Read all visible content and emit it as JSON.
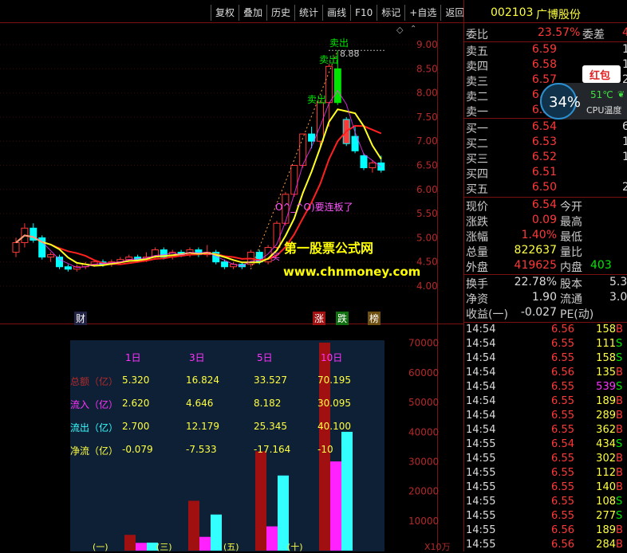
{
  "toolbar": {
    "buttons": [
      "复权",
      "叠加",
      "历史",
      "统计",
      "画线",
      "F10",
      "标记",
      "+自选",
      "返回"
    ]
  },
  "stock": {
    "code": "002103",
    "name": "广博股份"
  },
  "colors": {
    "up": "#ff3838",
    "down": "#00ffff",
    "green": "#00e600",
    "yellow": "#ffff00",
    "magenta": "#ff33ff",
    "dark_red": "#a01010"
  },
  "order_book": {
    "weibi_label": "委比",
    "weibi_value": "23.57%",
    "weicha_label": "委差",
    "weicha_value": "4",
    "asks": [
      {
        "label": "卖五",
        "price": "6.59",
        "vol": "1"
      },
      {
        "label": "卖四",
        "price": "6.58",
        "vol": "1"
      },
      {
        "label": "卖三",
        "price": "6.57",
        "vol": "2"
      },
      {
        "label": "卖二",
        "price": "6.56",
        "vol": ""
      },
      {
        "label": "卖一",
        "price": "6.55",
        "vol": ""
      }
    ],
    "bids": [
      {
        "label": "买一",
        "price": "6.54",
        "vol": "6"
      },
      {
        "label": "买二",
        "price": "6.53",
        "vol": "1"
      },
      {
        "label": "买三",
        "price": "6.52",
        "vol": "1"
      },
      {
        "label": "买四",
        "price": "6.51",
        "vol": ""
      },
      {
        "label": "买五",
        "price": "6.50",
        "vol": "2"
      }
    ]
  },
  "quote": [
    {
      "label": "现价",
      "value": "6.54",
      "label2": "今开",
      "value2": ""
    },
    {
      "label": "涨跌",
      "value": "0.09",
      "label2": "最高",
      "value2": ""
    },
    {
      "label": "涨幅",
      "value": "1.40%",
      "label2": "最低",
      "value2": ""
    },
    {
      "label": "总量",
      "value": "822637",
      "label2": "量比",
      "value2": ""
    },
    {
      "label": "外盘",
      "value": "419625",
      "label2": "内盘",
      "value2": "403"
    }
  ],
  "fundamentals": [
    {
      "label": "换手",
      "value": "22.78%",
      "label2": "股本",
      "value2": "5.3"
    },
    {
      "label": "净资",
      "value": "1.90",
      "label2": "流通",
      "value2": "3.0"
    },
    {
      "label": "收益(一)",
      "value": "-0.027",
      "label2": "PE(动)",
      "value2": ""
    }
  ],
  "ticks": [
    {
      "time": "14:54",
      "price": "6.56",
      "vol": "158",
      "side": "B"
    },
    {
      "time": "14:54",
      "price": "6.55",
      "vol": "111",
      "side": "S"
    },
    {
      "time": "14:54",
      "price": "6.55",
      "vol": "158",
      "side": "S"
    },
    {
      "time": "14:54",
      "price": "6.56",
      "vol": "135",
      "side": "B"
    },
    {
      "time": "14:54",
      "price": "6.55",
      "vol": "539",
      "side": "S"
    },
    {
      "time": "14:54",
      "price": "6.55",
      "vol": "189",
      "side": "B"
    },
    {
      "time": "14:54",
      "price": "6.55",
      "vol": "289",
      "side": "B"
    },
    {
      "time": "14:54",
      "price": "6.55",
      "vol": "362",
      "side": "B"
    },
    {
      "time": "14:55",
      "price": "6.54",
      "vol": "434",
      "side": "S"
    },
    {
      "time": "14:55",
      "price": "6.55",
      "vol": "302",
      "side": "B"
    },
    {
      "time": "14:55",
      "price": "6.55",
      "vol": "112",
      "side": "B"
    },
    {
      "time": "14:55",
      "price": "6.55",
      "vol": "140",
      "side": "B"
    },
    {
      "time": "14:55",
      "price": "6.55",
      "vol": "108",
      "side": "S"
    },
    {
      "time": "14:55",
      "price": "6.55",
      "vol": "277",
      "side": "S"
    },
    {
      "time": "14:55",
      "price": "6.56",
      "vol": "189",
      "side": "B"
    },
    {
      "time": "14:55",
      "price": "6.56",
      "vol": "284",
      "side": "B"
    }
  ],
  "overlay": {
    "hongbao": "红包",
    "cpu_percent": "34%",
    "cpu_temp": "51℃",
    "cpu_label": "CPU温度"
  },
  "chart_annotations": {
    "sell_labels": [
      "卖出",
      "卖出",
      "卖出"
    ],
    "high_price": "8.88",
    "pattern_text": "O^_^O)要连板了",
    "watermark_title": "第一股票公式网",
    "watermark_url": "www.chnmoney.com",
    "buy_tag": "买",
    "marker_cai": "财",
    "marker_zhang": "涨",
    "marker_die": "跌",
    "marker_bang": "榜"
  },
  "chart_data": [
    {
      "type": "candlestick",
      "y_axis_labels": [
        "9.00",
        "8.50",
        "8.00",
        "7.50",
        "7.00",
        "6.50",
        "6.00",
        "5.50",
        "5.00",
        "4.50",
        "4.00"
      ],
      "ylim": [
        3.9,
        9.15
      ],
      "candles": [
        [
          4.7,
          4.9,
          4.6,
          5.0
        ],
        [
          4.9,
          5.2,
          4.8,
          5.3
        ],
        [
          5.2,
          4.95,
          4.9,
          5.3
        ],
        [
          5.0,
          4.6,
          4.55,
          5.05
        ],
        [
          4.6,
          4.65,
          4.5,
          4.7
        ],
        [
          4.6,
          4.4,
          4.35,
          4.65
        ],
        [
          4.4,
          4.35,
          4.3,
          4.45
        ],
        [
          4.35,
          4.4,
          4.3,
          4.45
        ],
        [
          4.4,
          4.45,
          4.35,
          4.5
        ],
        [
          4.45,
          4.5,
          4.4,
          4.55
        ],
        [
          4.5,
          4.45,
          4.4,
          4.55
        ],
        [
          4.45,
          4.5,
          4.4,
          4.55
        ],
        [
          4.5,
          4.55,
          4.45,
          4.6
        ],
        [
          4.55,
          4.6,
          4.5,
          4.65
        ],
        [
          4.6,
          4.55,
          4.5,
          4.65
        ],
        [
          4.55,
          4.6,
          4.5,
          4.7
        ],
        [
          4.6,
          4.75,
          4.55,
          4.8
        ],
        [
          4.75,
          4.6,
          4.55,
          4.8
        ],
        [
          4.6,
          4.7,
          4.55,
          4.75
        ],
        [
          4.7,
          4.65,
          4.6,
          4.75
        ],
        [
          4.65,
          4.75,
          4.6,
          4.8
        ],
        [
          4.75,
          4.65,
          4.6,
          4.8
        ],
        [
          4.65,
          4.7,
          4.6,
          4.85
        ],
        [
          4.7,
          4.5,
          4.45,
          4.75
        ],
        [
          4.5,
          4.4,
          4.35,
          4.55
        ],
        [
          4.4,
          4.45,
          4.35,
          4.5
        ],
        [
          4.45,
          4.4,
          4.35,
          4.5
        ],
        [
          4.45,
          4.7,
          4.4,
          4.75
        ],
        [
          4.7,
          4.5,
          4.45,
          4.75
        ],
        [
          4.5,
          4.8,
          4.45,
          4.85
        ],
        [
          4.8,
          5.3,
          4.75,
          5.35
        ],
        [
          5.3,
          5.9,
          5.25,
          5.95
        ],
        [
          5.9,
          6.5,
          5.85,
          6.5
        ],
        [
          6.5,
          7.15,
          6.45,
          7.15
        ],
        [
          7.15,
          7.0,
          6.85,
          7.3
        ],
        [
          7.0,
          7.8,
          6.9,
          7.85
        ],
        [
          7.8,
          8.55,
          7.3,
          8.6
        ],
        [
          8.5,
          7.8,
          7.75,
          8.88
        ],
        [
          7.45,
          6.95,
          6.9,
          7.5
        ],
        [
          7.1,
          6.8,
          6.75,
          7.3
        ],
        [
          6.7,
          6.45,
          6.4,
          6.75
        ],
        [
          6.45,
          6.55,
          6.35,
          6.6
        ],
        [
          6.55,
          6.4,
          6.35,
          6.7
        ]
      ]
    },
    {
      "type": "bar",
      "categories": [
        "(一)",
        "(三)",
        "(五)",
        "(十)"
      ],
      "unit_label": "X10万",
      "y_axis_labels": [
        "70000",
        "60000",
        "50000",
        "40000",
        "30000",
        "20000",
        "10000"
      ],
      "ylim": [
        0,
        71000
      ],
      "series": [
        {
          "name": "总额",
          "values": [
            5320,
            16824,
            33527,
            70195
          ]
        },
        {
          "name": "流入",
          "values": [
            2620,
            4646,
            8182,
            30095
          ]
        },
        {
          "name": "流出",
          "values": [
            2700,
            12179,
            25345,
            40100
          ]
        }
      ]
    }
  ],
  "fund_table": {
    "headers": [
      "1日",
      "3日",
      "5日",
      "10日"
    ],
    "rows": [
      {
        "label": "总额（亿）",
        "values": [
          "5.320",
          "16.824",
          "33.527",
          "70.195"
        ]
      },
      {
        "label": "流入（亿）",
        "values": [
          "2.620",
          "4.646",
          "8.182",
          "30.095"
        ]
      },
      {
        "label": "流出（亿）",
        "values": [
          "2.700",
          "12.179",
          "25.345",
          "40.100"
        ]
      },
      {
        "label": "净流（亿）",
        "values": [
          "-0.079",
          "-7.533",
          "-17.164",
          "-10"
        ]
      }
    ]
  }
}
